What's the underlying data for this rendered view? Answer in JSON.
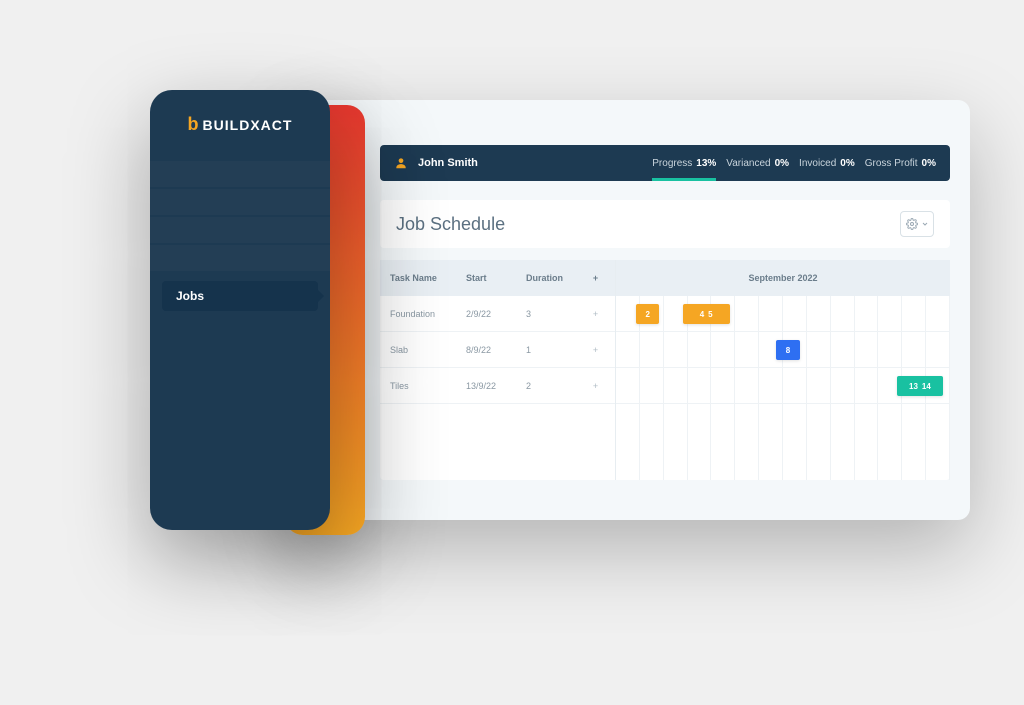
{
  "brand": {
    "name": "BUILDXACT"
  },
  "sidebar": {
    "active_label": "Jobs"
  },
  "header": {
    "user_name": "John Smith",
    "stats": [
      {
        "label": "Progress",
        "value": "13%"
      },
      {
        "label": "Varianced",
        "value": "0%"
      },
      {
        "label": "Invoiced",
        "value": "0%"
      },
      {
        "label": "Gross Profit",
        "value": "0%"
      }
    ]
  },
  "page": {
    "title": "Job Schedule"
  },
  "schedule": {
    "columns": {
      "task": "Task Name",
      "start": "Start",
      "duration": "Duration",
      "plus": "+"
    },
    "month_label": "September 2022",
    "tasks": [
      {
        "name": "Foundation",
        "start": "2/9/22",
        "duration": "3",
        "bar": {
          "labels": [
            "2",
            "4",
            "5"
          ],
          "color": "#f5a623",
          "left_pct": 6,
          "width_pct": 24,
          "split": true
        }
      },
      {
        "name": "Slab",
        "start": "8/9/22",
        "duration": "1",
        "bar": {
          "labels": [
            "8"
          ],
          "color": "#2e6ff2",
          "left_pct": 48,
          "width_pct": 7
        }
      },
      {
        "name": "Tiles",
        "start": "13/9/22",
        "duration": "2",
        "bar": {
          "labels": [
            "13",
            "14"
          ],
          "color": "#19c1a1",
          "left_pct": 84,
          "width_pct": 14
        }
      }
    ]
  }
}
